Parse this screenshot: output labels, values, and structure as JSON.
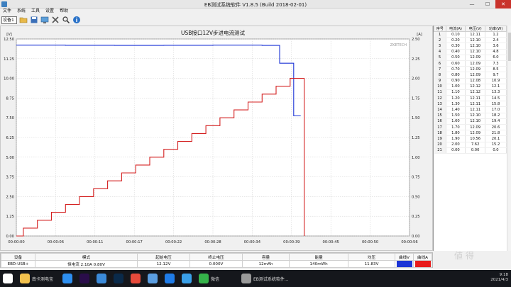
{
  "window": {
    "title": "EB测试系统软件 V1.8.5 (Build 2018-02-01)",
    "controls": [
      "—",
      "☐",
      "✕"
    ]
  },
  "menu": [
    "文件",
    "系统",
    "工具",
    "设置",
    "帮助"
  ],
  "toolbar": {
    "device_select": "设备1",
    "icons": [
      "folder-open-icon",
      "save-icon",
      "monitor-icon",
      "settings-icon",
      "search-icon",
      "info-icon"
    ]
  },
  "chart_data": {
    "type": "line",
    "title": "USB接口12V步进电流测试",
    "watermark": "ZKETECH",
    "left_unit": "[V]",
    "right_unit": "[A]",
    "ylim_left": [
      0,
      12.5
    ],
    "ylim_right": [
      0,
      2.5
    ],
    "yticks_left": [
      "12.50",
      "11.25",
      "10.00",
      "8.75",
      "7.50",
      "6.25",
      "5.00",
      "3.75",
      "2.50",
      "1.25",
      "0.00"
    ],
    "yticks_right": [
      "2.50",
      "2.25",
      "2.00",
      "1.75",
      "1.50",
      "1.25",
      "1.00",
      "0.75",
      "0.50",
      "0.25",
      "0.00"
    ],
    "xticks": [
      "00:00:00",
      "00:00:06",
      "00:00:11",
      "00:00:17",
      "00:00:22",
      "00:00:28",
      "00:00:34",
      "00:00:39",
      "00:00:45",
      "00:00:50",
      "00:00:56"
    ],
    "xlim": [
      0,
      56
    ],
    "grid": true,
    "series": [
      {
        "axis": "left",
        "color": "#1c34d6",
        "x": [
          0,
          7,
          7,
          14,
          14,
          21,
          21,
          28,
          28,
          35,
          35,
          37.5,
          37.5,
          39.5,
          39.5,
          40.5
        ],
        "y": [
          12.11,
          12.11,
          12.1,
          12.1,
          12.09,
          12.09,
          12.1,
          12.1,
          12.11,
          12.11,
          12.09,
          12.09,
          10.96,
          10.96,
          7.62,
          7.62
        ]
      },
      {
        "axis": "right",
        "color": "#d42020",
        "x": [
          0,
          1,
          1,
          3,
          3,
          5,
          5,
          7,
          7,
          9,
          9,
          11,
          11,
          13,
          13,
          15,
          15,
          17,
          17,
          19,
          19,
          21,
          21,
          23,
          23,
          25,
          25,
          27,
          27,
          29,
          29,
          31,
          31,
          33,
          33,
          35,
          35,
          37,
          37,
          39,
          39,
          41,
          41
        ],
        "y": [
          0.0,
          0.0,
          0.1,
          0.1,
          0.2,
          0.2,
          0.3,
          0.3,
          0.4,
          0.4,
          0.5,
          0.5,
          0.6,
          0.6,
          0.7,
          0.7,
          0.8,
          0.8,
          0.9,
          0.9,
          1.0,
          1.0,
          1.1,
          1.1,
          1.2,
          1.2,
          1.3,
          1.3,
          1.4,
          1.4,
          1.5,
          1.5,
          1.6,
          1.6,
          1.7,
          1.7,
          1.8,
          1.8,
          1.9,
          1.9,
          2.0,
          2.0,
          0.0
        ]
      }
    ]
  },
  "table": {
    "headers": [
      "序号",
      "电流(A)",
      "电压(V)",
      "功率(W)"
    ],
    "rows": [
      [
        "1",
        "0.10",
        "12.11",
        "1.2"
      ],
      [
        "2",
        "0.20",
        "12.10",
        "2.4"
      ],
      [
        "3",
        "0.30",
        "12.10",
        "3.6"
      ],
      [
        "4",
        "0.40",
        "12.10",
        "4.8"
      ],
      [
        "5",
        "0.50",
        "12.09",
        "6.0"
      ],
      [
        "6",
        "0.60",
        "12.09",
        "7.3"
      ],
      [
        "7",
        "0.70",
        "12.09",
        "8.5"
      ],
      [
        "8",
        "0.80",
        "12.09",
        "9.7"
      ],
      [
        "9",
        "0.90",
        "12.08",
        "10.9"
      ],
      [
        "10",
        "1.00",
        "12.12",
        "12.1"
      ],
      [
        "11",
        "1.10",
        "12.12",
        "13.3"
      ],
      [
        "12",
        "1.20",
        "12.11",
        "14.5"
      ],
      [
        "13",
        "1.30",
        "12.11",
        "15.8"
      ],
      [
        "14",
        "1.40",
        "12.11",
        "17.0"
      ],
      [
        "15",
        "1.50",
        "12.10",
        "18.2"
      ],
      [
        "16",
        "1.60",
        "12.10",
        "19.4"
      ],
      [
        "17",
        "1.70",
        "12.09",
        "20.6"
      ],
      [
        "18",
        "1.80",
        "12.09",
        "21.8"
      ],
      [
        "19",
        "1.90",
        "10.56",
        "20.1"
      ],
      [
        "20",
        "2.00",
        "7.62",
        "15.2"
      ],
      [
        "21",
        "0.00",
        "0.00",
        "0.0"
      ]
    ]
  },
  "status": {
    "headers": [
      "设备",
      "模式",
      "起始电压",
      "终止电压",
      "容量",
      "能量",
      "均压",
      "曲线V",
      "曲线A"
    ],
    "values": [
      "EBD-USB+",
      "恒电流  2.10A  0.80V",
      "12.12V",
      "0.000V",
      "12mAh",
      "140mWh",
      "11.83V",
      "",
      ""
    ],
    "curve_v_color": "#1c34d6",
    "curve_a_color": "#e81a1a"
  },
  "taskbar": {
    "apps": [
      {
        "name": "win-start-icon",
        "color": "#ffffff",
        "label": ""
      },
      {
        "name": "folder-icon",
        "color": "#f2c14e",
        "label": "南卡测电宝"
      },
      {
        "name": "sogou-icon",
        "color": "#2d8ff0",
        "label": ""
      },
      {
        "name": "premiere-icon",
        "color": "#2a0d4a",
        "label": ""
      },
      {
        "name": "browser-icon",
        "color": "#3b8ad9",
        "label": ""
      },
      {
        "name": "photoshop-icon",
        "color": "#0a2a4a",
        "label": ""
      },
      {
        "name": "chrome-icon",
        "color": "#e64a3b",
        "label": ""
      },
      {
        "name": "app-icon",
        "color": "#5a9de0",
        "label": ""
      },
      {
        "name": "kugou-icon",
        "color": "#1f7ce8",
        "label": ""
      },
      {
        "name": "bird-icon",
        "color": "#3aa0e8",
        "label": ""
      },
      {
        "name": "wechat-icon",
        "color": "#35b34a",
        "label": "微信"
      },
      {
        "name": "eb-test-icon",
        "color": "#9a9a9a",
        "label": "EB测试系统软件..."
      }
    ],
    "tray_time": "9:18",
    "tray_date": "2021/4/3"
  }
}
